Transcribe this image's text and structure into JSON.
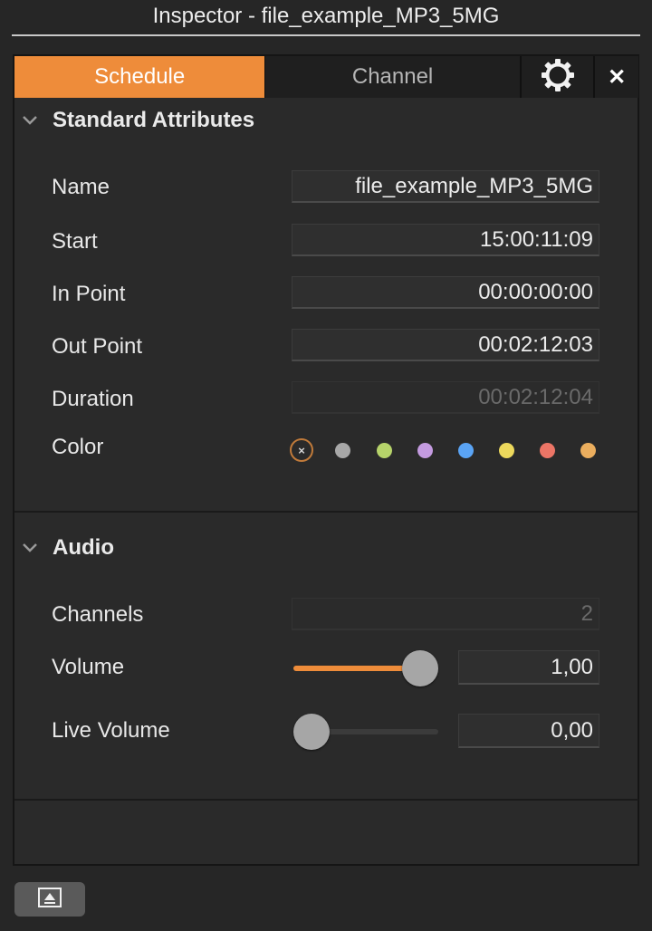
{
  "window": {
    "title": "Inspector - file_example_MP3_5MG"
  },
  "tabs": [
    {
      "label": "Schedule",
      "active": true
    },
    {
      "label": "Channel",
      "active": false
    }
  ],
  "icons": {
    "gear": "gear-icon",
    "close": "close-icon",
    "collapse": "chevron-down-icon",
    "bottom": "eject-icon"
  },
  "close_glyph": "✕",
  "standard": {
    "header": "Standard Attributes",
    "name_label": "Name",
    "name_value": "file_example_MP3_5MG",
    "start_label": "Start",
    "start_value": "15:00:11:09",
    "in_label": "In Point",
    "in_value": "00:00:00:00",
    "out_label": "Out Point",
    "out_value": "00:02:12:03",
    "duration_label": "Duration",
    "duration_value": "00:02:12:04",
    "color_label": "Color",
    "colors": [
      "#a8a8a8",
      "#b6d36a",
      "#c49be0",
      "#5aa4f5",
      "#ecd85c",
      "#ec7566",
      "#ebae5e"
    ],
    "no_color_glyph": "×"
  },
  "audio": {
    "header": "Audio",
    "channels_label": "Channels",
    "channels_value": "2",
    "volume_label": "Volume",
    "volume_value": "1,00",
    "volume_level": 1.0,
    "live_label": "Live Volume",
    "live_value": "0,00",
    "live_level": 0.0
  },
  "colors": {
    "accent": "#ee8c3a"
  }
}
